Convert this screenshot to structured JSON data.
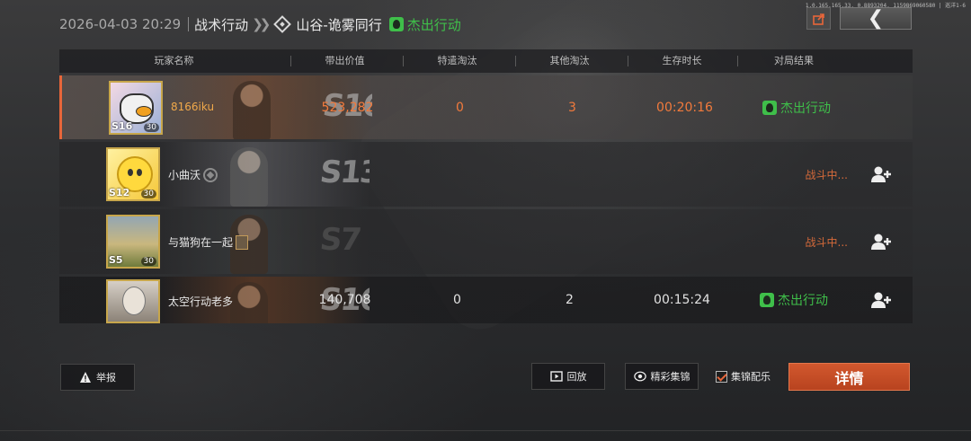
{
  "header": {
    "datetime": "2026-04-03 20:29",
    "mode": "战术行动",
    "map": "山谷-诡雾同行",
    "result": "杰出行动"
  },
  "top_info": "1.0.165.165.33, 0.8893204, 1159869060580 | 巡洋1-6",
  "table": {
    "columns": [
      "玩家名称",
      "带出价值",
      "特遣淘汰",
      "其他淘汰",
      "生存时长",
      "对局结果"
    ],
    "rows": [
      {
        "name": "8166iku",
        "season": "S16",
        "avatar_season": "S16",
        "level": "30",
        "value": "523,282",
        "special_kills": "0",
        "other_kills": "3",
        "survival": "00:20:16",
        "result": "杰出行动",
        "status": ""
      },
      {
        "name": "小曲沃",
        "season": "S13",
        "avatar_season": "S12",
        "level": "30",
        "value": "",
        "special_kills": "",
        "other_kills": "",
        "survival": "",
        "result": "",
        "status": "战斗中..."
      },
      {
        "name": "与猫狗在一起",
        "season": "S7",
        "avatar_season": "S5",
        "level": "30",
        "value": "",
        "special_kills": "",
        "other_kills": "",
        "survival": "",
        "result": "",
        "status": "战斗中..."
      },
      {
        "name": "太空行动老多",
        "season": "S16",
        "avatar_season": "",
        "level": "",
        "value": "140,708",
        "special_kills": "0",
        "other_kills": "2",
        "survival": "00:15:24",
        "result": "杰出行动",
        "status": ""
      }
    ]
  },
  "buttons": {
    "report": "举报",
    "replay": "回放",
    "highlights": "精彩集锦",
    "music": "集锦配乐",
    "details": "详情"
  },
  "colors": {
    "accent": "#d2582e",
    "success": "#3fbf4a",
    "highlight_text": "#f27a3c"
  }
}
